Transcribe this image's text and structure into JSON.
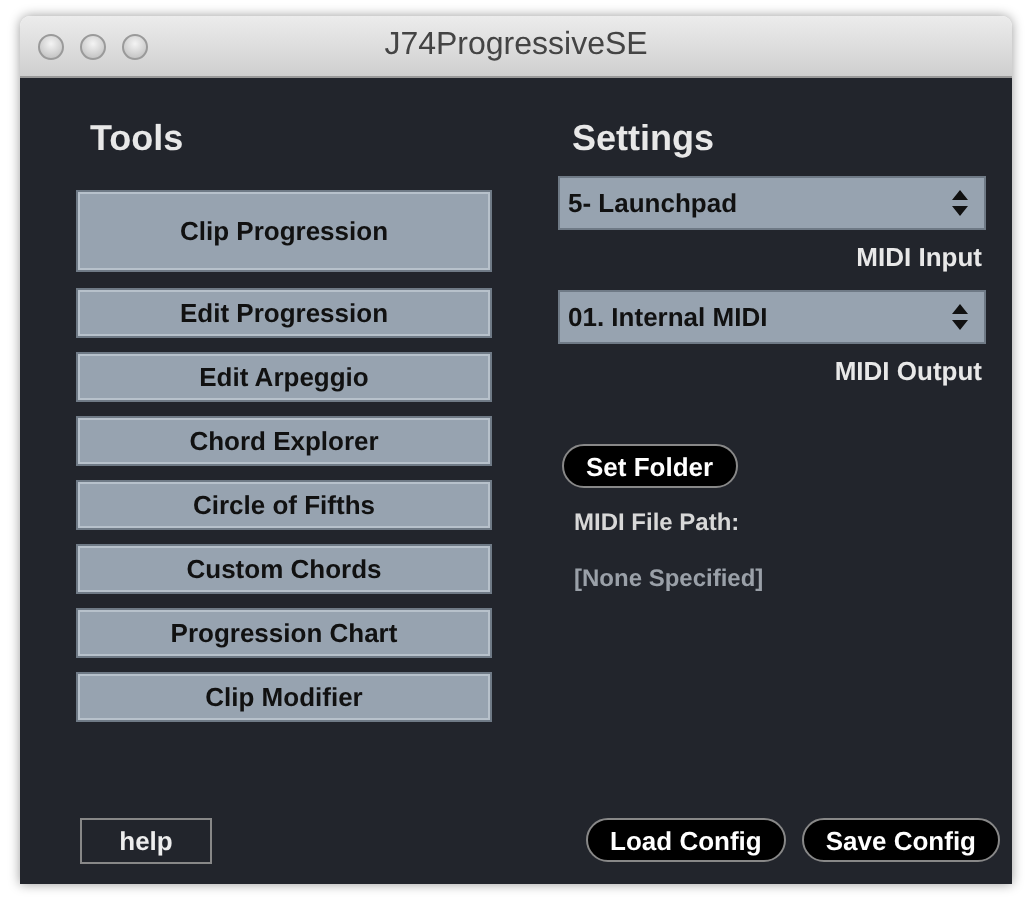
{
  "window": {
    "title": "J74ProgressiveSE"
  },
  "tools": {
    "heading": "Tools",
    "buttons": [
      {
        "label": "Clip Progression",
        "kind": "large"
      },
      {
        "label": "Edit Progression",
        "kind": "small"
      },
      {
        "label": "Edit Arpeggio",
        "kind": "small"
      },
      {
        "label": "Chord Explorer",
        "kind": "small"
      },
      {
        "label": "Circle of Fifths",
        "kind": "small"
      },
      {
        "label": "Custom Chords",
        "kind": "small"
      },
      {
        "label": "Progression Chart",
        "kind": "small"
      },
      {
        "label": "Clip Modifier",
        "kind": "small"
      }
    ]
  },
  "settings": {
    "heading": "Settings",
    "midi_input": {
      "value": "5- Launchpad",
      "label": "MIDI Input"
    },
    "midi_output": {
      "value": "01. Internal MIDI",
      "label": "MIDI Output"
    },
    "set_folder": "Set Folder",
    "file_path_label": "MIDI File Path:",
    "file_path": "[None Specified]"
  },
  "footer": {
    "help": "help",
    "load": "Load Config",
    "save": "Save Config"
  }
}
